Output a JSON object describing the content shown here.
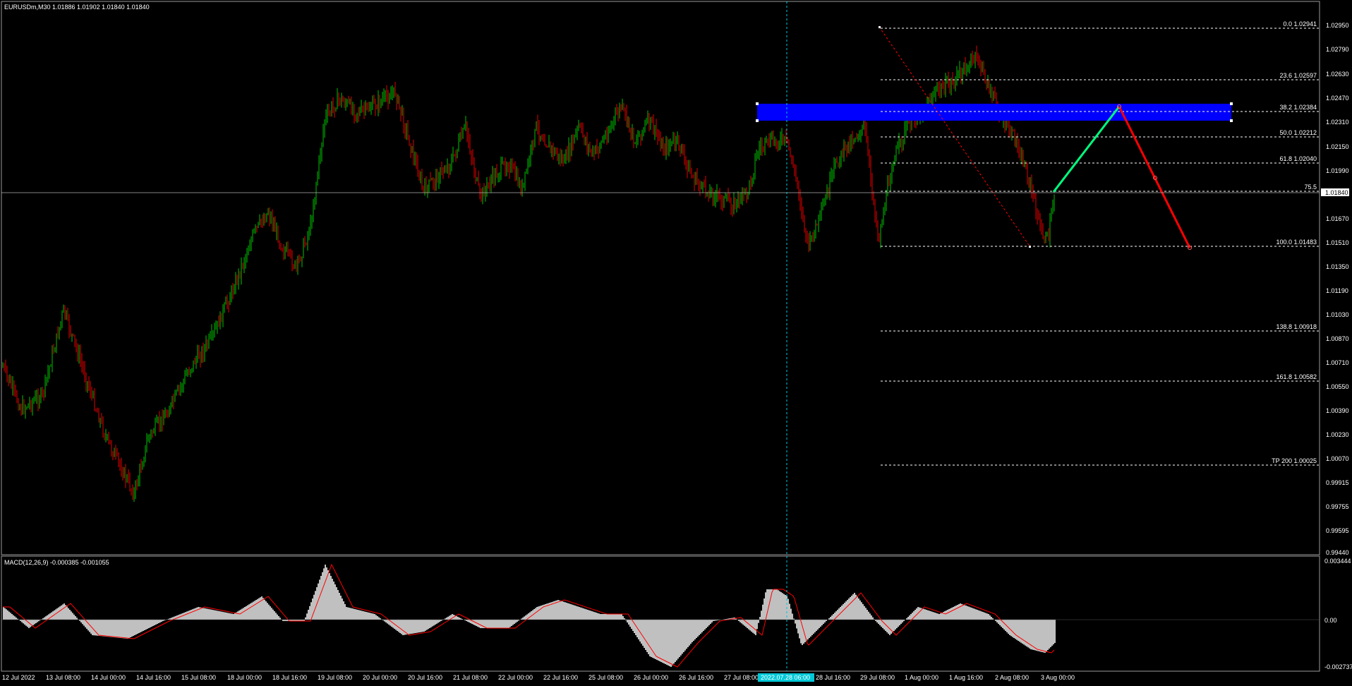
{
  "main": {
    "info": "EURUSDm,M30  1.01886 1.01902 1.01840 1.01840",
    "price_scale": [
      "1.02950",
      "1.02790",
      "1.02630",
      "1.02470",
      "1.02310",
      "1.02150",
      "1.01990",
      "1.01840",
      "1.01670",
      "1.01510",
      "1.01350",
      "1.01190",
      "1.01030",
      "1.00870",
      "1.00710",
      "1.00550",
      "1.00390",
      "1.00230",
      "1.00070",
      "0.99915",
      "0.99755",
      "0.99595",
      "0.99440"
    ],
    "current_price": "1.01840"
  },
  "fib": {
    "labels": [
      "0.0 1.02941",
      "23.6 1.02597",
      "38.2 1.02384",
      "50.0 1.02212",
      "61.8 1.02040",
      "75.5",
      "100.0 1.01483",
      "138.8 1.00918",
      "161.8 1.00582",
      "TP 200 1.00025"
    ]
  },
  "macd": {
    "info": "MACD(12,26,9) -0.000385 -0.001055",
    "scale": [
      "0.003444",
      "0.00",
      "-0.002737"
    ]
  },
  "time_axis": {
    "labels": [
      "12 Jul 2022",
      "13 Jul 08:00",
      "14 Jul 00:00",
      "14 Jul 16:00",
      "15 Jul 08:00",
      "18 Jul 00:00",
      "18 Jul 16:00",
      "19 Jul 08:00",
      "20 Jul 00:00",
      "20 Jul 16:00",
      "21 Jul 08:00",
      "22 Jul 00:00",
      "22 Jul 16:00",
      "25 Jul 08:00",
      "26 Jul 00:00",
      "26 Jul 16:00",
      "27 Jul 08:00",
      "28 Jul 16:00",
      "29 Jul 08:00",
      "1 Aug 00:00",
      "1 Aug 16:00",
      "2 Aug 08:00",
      "3 Aug 00:00"
    ],
    "cursor_label": "2022.07.28 06:00"
  },
  "colors": {
    "bull": "#00c000",
    "bear": "#e00000",
    "zone": "#0000ff",
    "projection_up": "#00ff7f",
    "projection_down": "#ff0000",
    "cursor": "#00c8d7",
    "macd_hist": "#c0c0c0",
    "macd_signal": "#ff0000"
  }
}
